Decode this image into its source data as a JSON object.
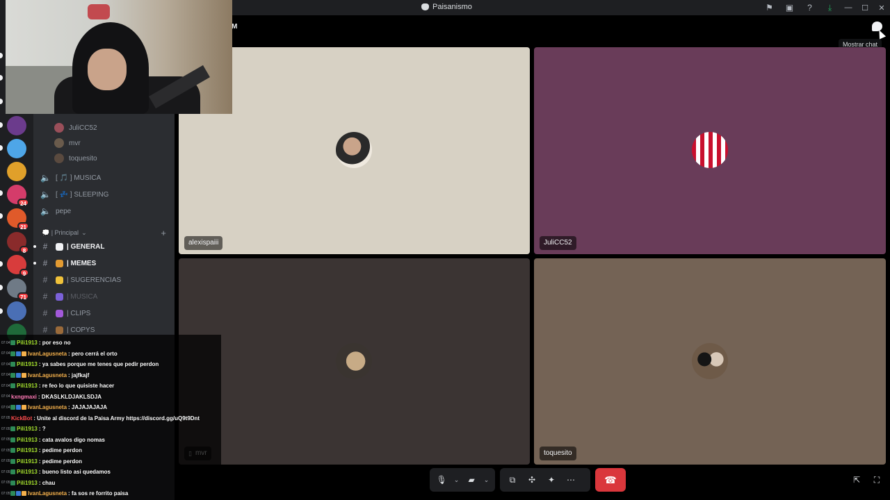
{
  "window": {
    "title": "Paisanismo"
  },
  "header": {
    "partial_text": "M",
    "chat_tooltip": "Mostrar chat"
  },
  "servers": [
    {
      "name": "server-1",
      "color": "#6b3b8c",
      "badge": ""
    },
    {
      "name": "server-2",
      "color": "#4ea6e8",
      "badge": ""
    },
    {
      "name": "server-3",
      "color": "#e0a02a",
      "badge": ""
    },
    {
      "name": "server-4",
      "color": "#d43c6a",
      "badge": "24"
    },
    {
      "name": "server-5",
      "color": "#e05a2a",
      "badge": "21"
    },
    {
      "name": "server-6",
      "color": "#8a2b2b",
      "badge": "8"
    },
    {
      "name": "server-7",
      "color": "#d83c3c",
      "badge": "9"
    },
    {
      "name": "server-8",
      "color": "#6f7a86",
      "badge": "71"
    },
    {
      "name": "server-9",
      "color": "#4a6fb5",
      "badge": ""
    },
    {
      "name": "server-10",
      "color": "#1f6a3a",
      "badge": ""
    }
  ],
  "voice_users": [
    {
      "name": "JuliCC52"
    },
    {
      "name": "mvr"
    },
    {
      "name": "toquesito"
    }
  ],
  "voice_channels": [
    {
      "label": "[ 🎵 ] MUSICA"
    },
    {
      "label": "[ 💤 ] SLEEPING"
    },
    {
      "label": "pepe"
    }
  ],
  "category": {
    "label": "💭 | Principal"
  },
  "text_channels": [
    {
      "label": "| GENERAL",
      "style": "bright",
      "emoji_color": "#f2f3f5"
    },
    {
      "label": "| MEMES",
      "style": "bright",
      "emoji_color": "#e39b32"
    },
    {
      "label": "| SUGERENCIAS",
      "style": "normal",
      "emoji_color": "#f0c23a"
    },
    {
      "label": "| MUSICA",
      "style": "dim",
      "emoji_color": "#7b61d8"
    },
    {
      "label": "| CLIPS",
      "style": "normal",
      "emoji_color": "#a259d9"
    },
    {
      "label": "| COPYS",
      "style": "normal",
      "emoji_color": "#9a6a3a"
    }
  ],
  "participants": [
    {
      "name": "alexispaiii",
      "bg": "#d7d1c4",
      "muted": false
    },
    {
      "name": "JuliCC52",
      "bg": "#693c59",
      "muted": false
    },
    {
      "name": "mvr",
      "bg": "#3b3433",
      "muted": true
    },
    {
      "name": "toquesito",
      "bg": "#746355",
      "muted": false
    }
  ],
  "chat_messages": [
    {
      "time": "07:04",
      "user": "Pili1913",
      "text": ": por eso no",
      "color": "u-green"
    },
    {
      "time": "07:04",
      "user": "IvanLagusneta",
      "text": ": pero cerrá el orto",
      "color": "u-orange"
    },
    {
      "time": "07:04",
      "user": "Pili1913",
      "text": ": ya sabes porque me tenes que pedir perdon",
      "color": "u-green"
    },
    {
      "time": "07:04",
      "user": "IvanLagusneta",
      "text": ": jajfkajf",
      "color": "u-orange"
    },
    {
      "time": "07:04",
      "user": "Pili1913",
      "text": ": re feo lo que quisiste hacer",
      "color": "u-green"
    },
    {
      "time": "07:04",
      "user": "kxngmaxi",
      "text": ": DKASLKLDJAKLSDJA",
      "color": "u-pink"
    },
    {
      "time": "07:04",
      "user": "IvanLagusneta",
      "text": ": JAJAJAJAJA",
      "color": "u-orange"
    },
    {
      "time": "07:05",
      "user": "KickBot",
      "text": ": Unite al discord de la Paisa Army https://discord.gg/uQ9t9Dnt",
      "color": "u-red"
    },
    {
      "time": "07:05",
      "user": "Pili1913",
      "text": ": ?",
      "color": "u-green"
    },
    {
      "time": "07:05",
      "user": "Pili1913",
      "text": ": cata avalos digo nomas",
      "color": "u-green"
    },
    {
      "time": "07:05",
      "user": "Pili1913",
      "text": ": pedime perdon",
      "color": "u-green"
    },
    {
      "time": "07:05",
      "user": "Pili1913",
      "text": ": pedime perdon",
      "color": "u-green"
    },
    {
      "time": "07:05",
      "user": "Pili1913",
      "text": ": bueno listo asi quedamos",
      "color": "u-green"
    },
    {
      "time": "07:05",
      "user": "Pili1913",
      "text": ": chau",
      "color": "u-green"
    },
    {
      "time": "07:05",
      "user": "IvanLagusneta",
      "text": ": fa sos re forrito paisa",
      "color": "u-orange"
    }
  ],
  "icons": {
    "microphone": "microphone-icon",
    "camera_off": "camera-off-icon",
    "screenshare": "screenshare-icon",
    "activities": "activities-icon",
    "soundboard": "soundboard-icon",
    "more": "more-icon",
    "hangup": "hangup-icon",
    "popout": "popout-icon",
    "fullscreen": "fullscreen-icon"
  }
}
